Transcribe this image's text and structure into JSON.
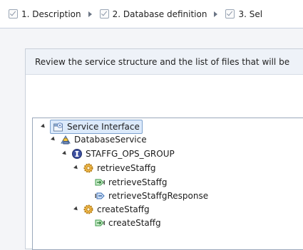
{
  "wizard": {
    "steps": [
      {
        "label": "1. Description"
      },
      {
        "label": "2. Database definition"
      },
      {
        "label": "3. Sel"
      }
    ]
  },
  "instruction": "Review the service structure and the list of files that will be",
  "tree": {
    "root": "Service Interface",
    "service": "DatabaseService",
    "group": "STAFFG_OPS_GROUP",
    "op1": "retrieveStaffg",
    "op1_in": "retrieveStaffg",
    "op1_out": "retrieveStaffgResponse",
    "op2": "createStaffg",
    "op2_in": "createStaffg"
  }
}
